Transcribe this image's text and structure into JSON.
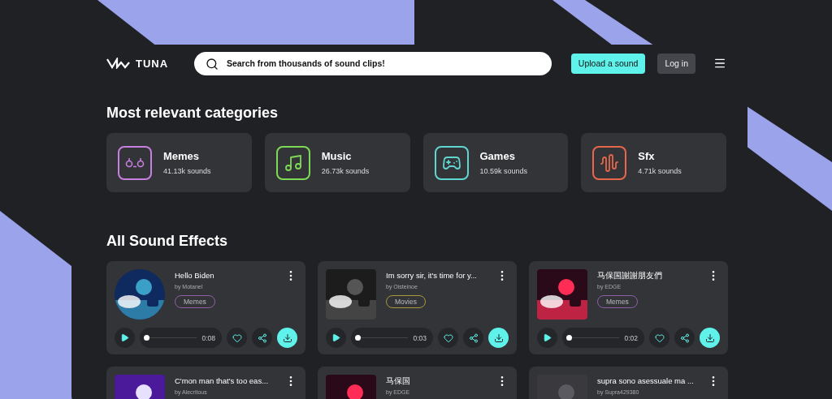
{
  "brand": {
    "name": "TUNA"
  },
  "search": {
    "placeholder": "Search from thousands of sound clips!"
  },
  "actions": [
    {
      "label": "Upload a sound",
      "kind": "primary"
    },
    {
      "label": "Log in",
      "kind": "secondary"
    }
  ],
  "categories_title": "Most relevant categories",
  "categories": [
    {
      "name": "Memes",
      "count": "41.13k sounds",
      "kind": "memes",
      "color": "#c77fe0"
    },
    {
      "name": "Music",
      "count": "26.73k sounds",
      "kind": "music",
      "color": "#7ed957"
    },
    {
      "name": "Games",
      "count": "10.59k sounds",
      "kind": "games",
      "color": "#5fd6d0"
    },
    {
      "name": "Sfx",
      "count": "4.71k sounds",
      "kind": "sfx",
      "color": "#e8674a"
    }
  ],
  "sounds_title": "All Sound Effects",
  "sounds": [
    {
      "title": "Hello Biden",
      "author": "by Motanel",
      "tag": {
        "label": "Memes",
        "color": "#8e5fa8"
      },
      "duration": "0:08",
      "level": 0
    },
    {
      "title": "Im sorry sir, it's time for y...",
      "author": "by Oisteinoe",
      "tag": {
        "label": "Movies",
        "color": "#a89a3c"
      },
      "duration": "0:03",
      "level": 0
    },
    {
      "title": "马保国謝謝朋友們",
      "author": "by EDGE",
      "tag": {
        "label": "Memes",
        "color": "#8e5fa8"
      },
      "duration": "0:02",
      "level": 0
    },
    {
      "title": "C'mon man that's too eas...",
      "author": "by Alecritous"
    },
    {
      "title": "马保国",
      "author": "by EDGE"
    },
    {
      "title": "supra sono asessuale ma ...",
      "author": "by Supra429380"
    }
  ]
}
